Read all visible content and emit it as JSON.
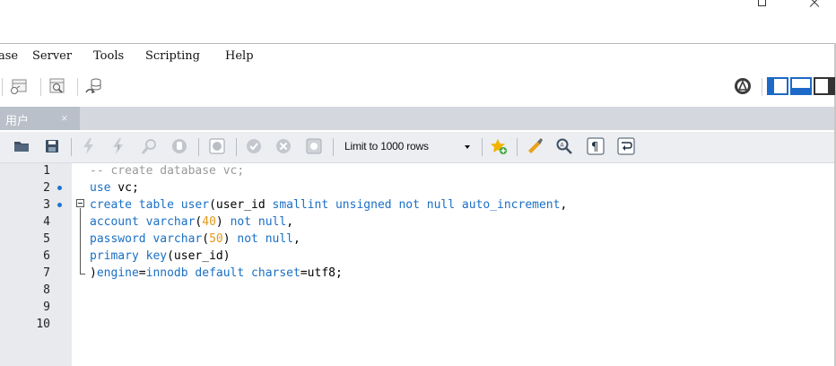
{
  "menu": {
    "items": [
      "ase",
      "Server",
      "Tools",
      "Scripting",
      "Help"
    ]
  },
  "tabs": [
    {
      "label": "用户",
      "close": "×"
    }
  ],
  "sql_toolbar": {
    "limit_select": "Limit to 1000 rows"
  },
  "editor": {
    "line_numbers": [
      "1",
      "2",
      "3",
      "4",
      "5",
      "6",
      "7",
      "8",
      "9",
      "10"
    ],
    "lines": [
      "-- create database vc;",
      "use vc;",
      "create table user(user_id smallint unsigned not null auto_increment,",
      "account varchar(40) not null,",
      "password varchar(50) not null,",
      "primary key(user_id)",
      ")engine=innodb default charset=utf8;",
      "",
      "",
      ""
    ],
    "marked_lines": [
      2,
      3
    ]
  },
  "colors": {
    "keyword": "#1a6fc4",
    "comment": "#9a9a9a",
    "number": "#e39a1a",
    "tab_active": "#b9c0c9",
    "gutter": "#e8eaed",
    "marker_dot": "#1e73d6"
  }
}
